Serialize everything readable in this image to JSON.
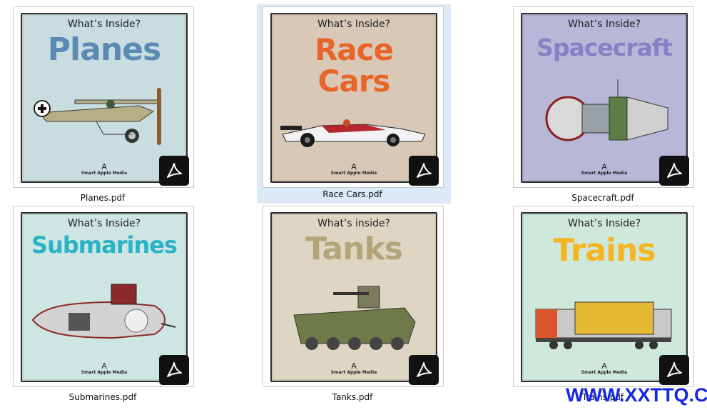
{
  "files": [
    {
      "filename": "Planes.pdf",
      "series": "What’s Inside?",
      "title": "Planes",
      "publisher": "Smart Apple Media",
      "cover_bg": "#c9dde0",
      "title_color": "#5b8bb5",
      "selected": false
    },
    {
      "filename": "Race Cars.pdf",
      "series": "What’s Inside?",
      "title": "Race Cars",
      "publisher": "Smart Apple Media",
      "cover_bg": "#d9c8b5",
      "title_color": "#e8652a",
      "selected": true
    },
    {
      "filename": "Spacecraft.pdf",
      "series": "What’s Inside?",
      "title": "Spacecraft",
      "publisher": "Smart Apple Media",
      "cover_bg": "#b7b7d8",
      "title_color": "#8581c4",
      "selected": false
    },
    {
      "filename": "Submarines.pdf",
      "series": "What’s Inside?",
      "title": "Submarines",
      "publisher": "Smart Apple Media",
      "cover_bg": "#cde6e2",
      "title_color": "#2ab3c6",
      "selected": false
    },
    {
      "filename": "Tanks.pdf",
      "series": "What’s inside?",
      "title": "Tanks",
      "publisher": "Smart Apple Media",
      "cover_bg": "#ded6c3",
      "title_color": "#b4a47a",
      "selected": false
    },
    {
      "filename": "Trains.pdf",
      "series": "What’s Inside?",
      "title": "Trains",
      "publisher": "Smart Apple Media",
      "cover_bg": "#cfe8dc",
      "title_color": "#f5b521",
      "selected": false
    }
  ],
  "file_icon": "pdf-icon",
  "watermark": "WWW.XXTTQ.COM"
}
